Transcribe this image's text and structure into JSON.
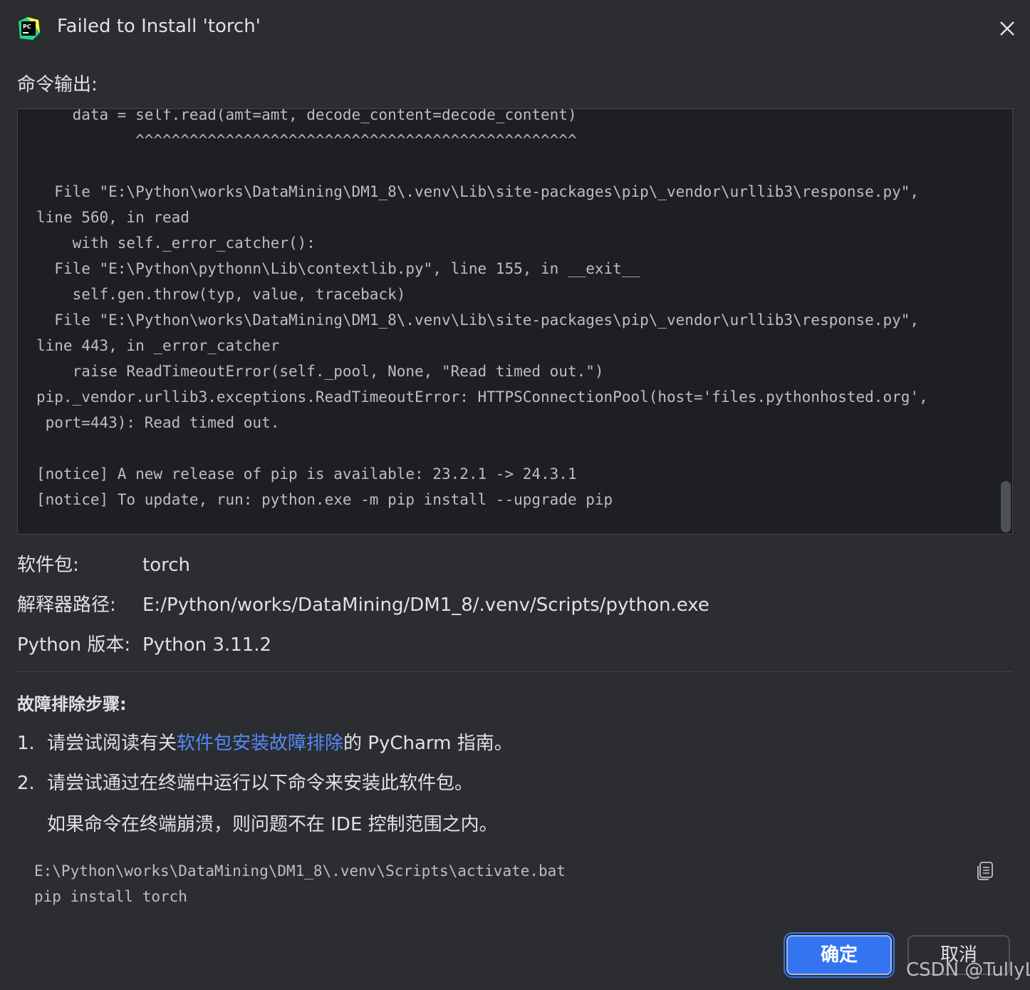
{
  "window": {
    "title": "Failed to Install 'torch'",
    "app_icon": "pycharm-logo-icon",
    "close_icon": "close-icon"
  },
  "output_section": {
    "label": "命令输出:",
    "lines": "    data = self.read(amt=amt, decode_content=decode_content)\n           ^^^^^^^^^^^^^^^^^^^^^^^^^^^^^^^^^^^^^^^^^^^^^^^^^\n\n  File \"E:\\Python\\works\\DataMining\\DM1_8\\.venv\\Lib\\site-packages\\pip\\_vendor\\urllib3\\response.py\",\nline 560, in read\n    with self._error_catcher():\n  File \"E:\\Python\\pythonn\\Lib\\contextlib.py\", line 155, in __exit__\n    self.gen.throw(typ, value, traceback)\n  File \"E:\\Python\\works\\DataMining\\DM1_8\\.venv\\Lib\\site-packages\\pip\\_vendor\\urllib3\\response.py\",\nline 443, in _error_catcher\n    raise ReadTimeoutError(self._pool, None, \"Read timed out.\")\npip._vendor.urllib3.exceptions.ReadTimeoutError: HTTPSConnectionPool(host='files.pythonhosted.org',\n port=443): Read timed out.\n\n[notice] A new release of pip is available: 23.2.1 -> 24.3.1\n[notice] To update, run: python.exe -m pip install --upgrade pip"
  },
  "info": {
    "package_label": "软件包:",
    "package_value": "torch",
    "interpreter_label": "解释器路径:",
    "interpreter_value": "E:/Python/works/DataMining/DM1_8/.venv/Scripts/python.exe",
    "python_label": "Python 版本:",
    "python_value": "Python 3.11.2"
  },
  "troubleshooting": {
    "heading": "故障排除步骤:",
    "step1_num": "1.",
    "step1_prefix": "请尝试阅读有关",
    "step1_link": "软件包安装故障排除",
    "step1_suffix": "的 PyCharm 指南。",
    "step2_num": "2.",
    "step2_text": "请尝试通过在终端中运行以下命令来安装此软件包。",
    "note": "如果命令在终端崩溃，则问题不在 IDE 控制范围之内。",
    "command": "E:\\Python\\works\\DataMining\\DM1_8\\.venv\\Scripts\\activate.bat\npip install torch",
    "copy_icon": "copy-icon"
  },
  "buttons": {
    "ok": "确定",
    "cancel": "取消"
  },
  "watermark": "CSDN @TullyL",
  "colors": {
    "background": "#2b2d30",
    "output_background": "#1e1f22",
    "link": "#548af7",
    "primary_button": "#3574f0"
  }
}
